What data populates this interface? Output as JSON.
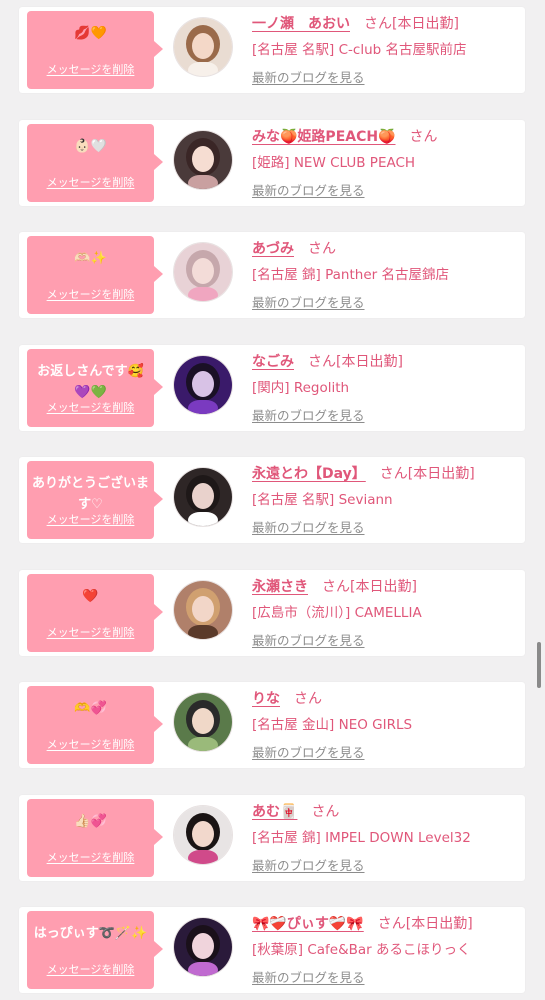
{
  "colors": {
    "accent": "#e0577a",
    "bubble": "#ff9eb0",
    "muted": "#8c8c8c",
    "page_bg": "#f1f0f1"
  },
  "items": [
    {
      "message": "💋🧡",
      "delete_label": "メッセージを削除",
      "name": "一ノ瀬　あおい",
      "honorific": "さん",
      "status": "[本日出勤]",
      "shop": "[名古屋 名駅] C-club 名古屋駅前店",
      "blog_label": "最新のブログを見る",
      "avatar": {
        "bg": "#e9dcd2",
        "skin": "#f4d8c8",
        "hair": "#9a6a4a",
        "accent": "#f7f0ea"
      }
    },
    {
      "message": "👶🏻🤍",
      "delete_label": "メッセージを削除",
      "name": "みな🍑姫路PEACH🍑",
      "honorific": "さん",
      "status": "",
      "shop": "[姫路] NEW CLUB PEACH",
      "blog_label": "最新のブログを見る",
      "avatar": {
        "bg": "#4a3a3a",
        "skin": "#f6ddd2",
        "hair": "#3a2626",
        "accent": "#c9a0a0"
      }
    },
    {
      "message": "🫶🏻✨",
      "delete_label": "メッセージを削除",
      "name": "あづみ",
      "honorific": "さん",
      "status": "",
      "shop": "[名古屋 錦] Panther 名古屋錦店",
      "blog_label": "最新のブログを見る",
      "avatar": {
        "bg": "#e8d2d6",
        "skin": "#f3dcd8",
        "hair": "#c6a8ac",
        "accent": "#f0a6c0"
      }
    },
    {
      "message": "お返しさんです🥰💜💚",
      "delete_label": "メッセージを削除",
      "name": "なごみ",
      "honorific": "さん",
      "status": "[本日出勤]",
      "shop": "[関内] Regolith",
      "blog_label": "最新のブログを見る",
      "avatar": {
        "bg": "#3a1a6a",
        "skin": "#d8c2e6",
        "hair": "#1a1026",
        "accent": "#7a3ac0"
      }
    },
    {
      "message": "ありがとうございます♡",
      "delete_label": "メッセージを削除",
      "name": "永遠とわ【Day】",
      "honorific": "さん",
      "status": "[本日出勤]",
      "shop": "[名古屋 名駅] Seviann",
      "blog_label": "最新のブログを見る",
      "avatar": {
        "bg": "#2e2626",
        "skin": "#e9d2cc",
        "hair": "#1e1818",
        "accent": "#ffffff"
      }
    },
    {
      "message": "❤️",
      "delete_label": "メッセージを削除",
      "name": "永瀬さき",
      "honorific": "さん",
      "status": "[本日出勤]",
      "shop": "[広島市（流川）] CAMELLIA",
      "blog_label": "最新のブログを見る",
      "avatar": {
        "bg": "#b0806a",
        "skin": "#f2d6c8",
        "hair": "#d0a070",
        "accent": "#5a3a2a"
      }
    },
    {
      "message": "🫶💞",
      "delete_label": "メッセージを削除",
      "name": "りな",
      "honorific": "さん",
      "status": "",
      "shop": "[名古屋 金山] NEO GIRLS",
      "blog_label": "最新のブログを見る",
      "avatar": {
        "bg": "#5a7a4a",
        "skin": "#f0d8c8",
        "hair": "#2a2a2a",
        "accent": "#9aba7a"
      }
    },
    {
      "message": "👍🏻💞",
      "delete_label": "メッセージを削除",
      "name": "あむ🀄",
      "honorific": "さん",
      "status": "",
      "shop": "[名古屋 錦] IMPEL DOWN Level32",
      "blog_label": "最新のブログを見る",
      "avatar": {
        "bg": "#e8e4e4",
        "skin": "#f2d8cc",
        "hair": "#1a1414",
        "accent": "#d04a8a"
      }
    },
    {
      "message": "はっぴぃす➰🪄✨",
      "delete_label": "メッセージを削除",
      "name": "🎀❤️‍🩹ぴぃす❤️‍🩹🎀",
      "honorific": "さん",
      "status": "[本日出勤]",
      "shop": "[秋葉原] Cafe&Bar あるこほりっく",
      "blog_label": "最新のブログを見る",
      "avatar": {
        "bg": "#2a1a3a",
        "skin": "#f0d4dc",
        "hair": "#1a101a",
        "accent": "#c06ad0"
      }
    }
  ]
}
